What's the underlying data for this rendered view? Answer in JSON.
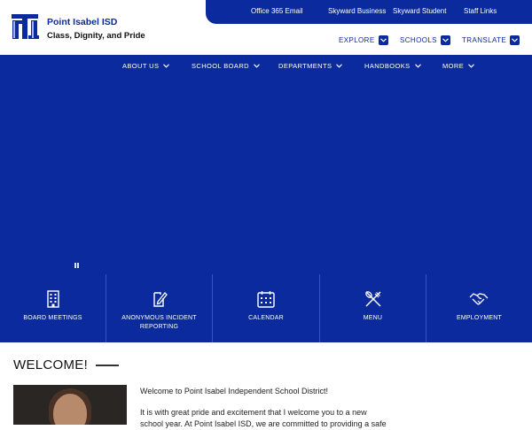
{
  "brand": {
    "logo_text": "PI",
    "name": "Point Isabel ISD",
    "tagline": "Class, Dignity, and Pride"
  },
  "utility_links": [
    "Office 365 Email",
    "Skyward Business",
    "Skyward Student",
    "Staff Links"
  ],
  "secondary_nav": [
    "EXPLORE",
    "SCHOOLS",
    "TRANSLATE"
  ],
  "main_nav": [
    "ABOUT US",
    "SCHOOL BOARD",
    "DEPARTMENTS",
    "HANDBOOKS",
    "MORE"
  ],
  "quick_links": [
    {
      "label": "BOARD MEETINGS",
      "icon": "building-icon"
    },
    {
      "label": "ANONYMOUS INCIDENT REPORTING",
      "icon": "edit-document-icon"
    },
    {
      "label": "CALENDAR",
      "icon": "calendar-icon"
    },
    {
      "label": "MENU",
      "icon": "utensils-icon"
    },
    {
      "label": "EMPLOYMENT",
      "icon": "handshake-icon"
    }
  ],
  "welcome": {
    "title": "WELCOME!",
    "paragraphs": [
      "Welcome to Point Isabel Independent School District!",
      "It is with great pride and excitement that I welcome you to a new",
      "school year. At Point Isabel ISD, we are committed to providing a safe"
    ]
  },
  "colors": {
    "primary_blue": "#0a2a9e",
    "white": "#ffffff",
    "text_dark": "#111111"
  }
}
